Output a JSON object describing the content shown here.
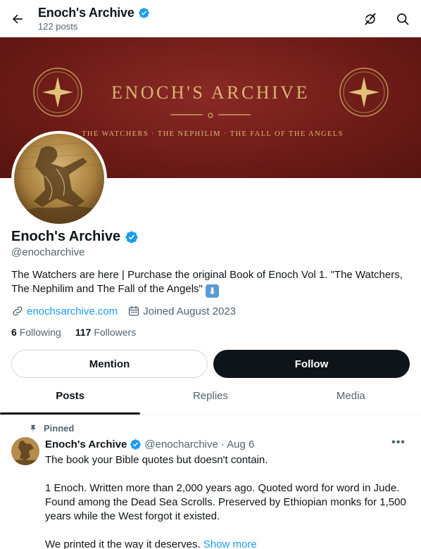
{
  "topbar": {
    "title": "Enoch's Archive",
    "post_count": "122 posts",
    "icons": [
      "back-arrow-icon",
      "grok-icon",
      "search-icon"
    ]
  },
  "banner": {
    "title": "ENOCH'S ARCHIVE",
    "subtitle": "THE WATCHERS · THE NEPHILIM · THE FALL OF THE ANGELS",
    "colors": {
      "background": "#6e1c18",
      "gold": "#c9a25e"
    }
  },
  "profile": {
    "name": "Enoch's Archive",
    "handle": "@enocharchive",
    "bio": "The Watchers are here | Purchase the original Book of Enoch Vol 1. \"The Watchers, The Nephilim and The Fall of the Angels\"",
    "bio_emoji": "⬇",
    "website": "enochsarchive.com",
    "joined": "Joined August 2023",
    "following_count": "6",
    "following_label": "Following",
    "followers_count": "117",
    "followers_label": "Followers"
  },
  "actions": {
    "mention_label": "Mention",
    "follow_label": "Follow"
  },
  "tabs": [
    {
      "label": "Posts",
      "active": true
    },
    {
      "label": "Replies",
      "active": false
    },
    {
      "label": "Media",
      "active": false
    }
  ],
  "post": {
    "pinned_label": "Pinned",
    "author_name": "Enoch's Archive",
    "author_handle": "@enocharchive",
    "date": "· Aug 6",
    "more": "•••",
    "line1": "The book your Bible quotes but doesn't contain.",
    "line2": "1 Enoch. Written more than 2,000 years ago. Quoted word for word in Jude. Found among the Dead Sea Scrolls. Preserved by Ethiopian monks for 1,500 years while the West forgot it existed.",
    "line3": "We printed it the way it deserves.",
    "show_more": "Show more"
  },
  "colors": {
    "accent": "#1d9bf0",
    "text": "#0f1419",
    "muted": "#536471",
    "verified": "#1d9bf0"
  }
}
